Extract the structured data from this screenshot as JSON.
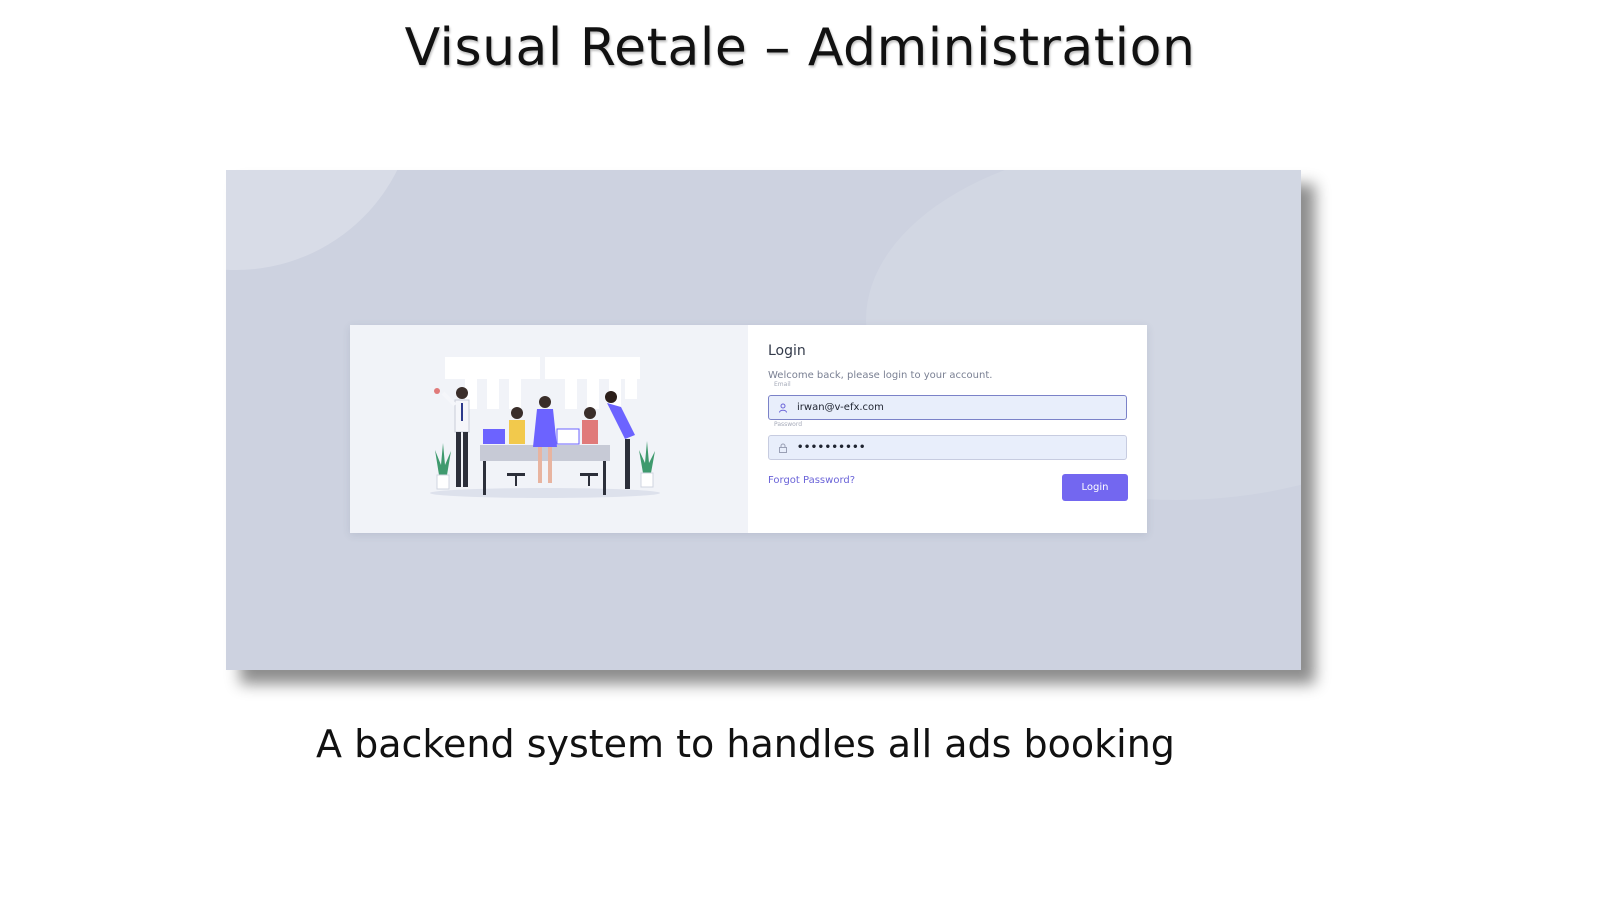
{
  "slide": {
    "title": "Visual Retale – Administration",
    "caption": "A backend system to handles all ads booking"
  },
  "login": {
    "title": "Login",
    "subtitle": "Welcome back, please login to your account.",
    "email_label": "Email",
    "email_value": "irwan@v-efx.com",
    "password_label": "Password",
    "password_value": "••••••••••",
    "forgot_link": "Forgot Password?",
    "login_button": "Login"
  },
  "icons": {
    "email_icon": "user-icon",
    "password_icon": "lock-icon"
  },
  "colors": {
    "accent": "#7367f0",
    "frame_background": "#cdd2e0",
    "field_background": "#e8eefb"
  }
}
